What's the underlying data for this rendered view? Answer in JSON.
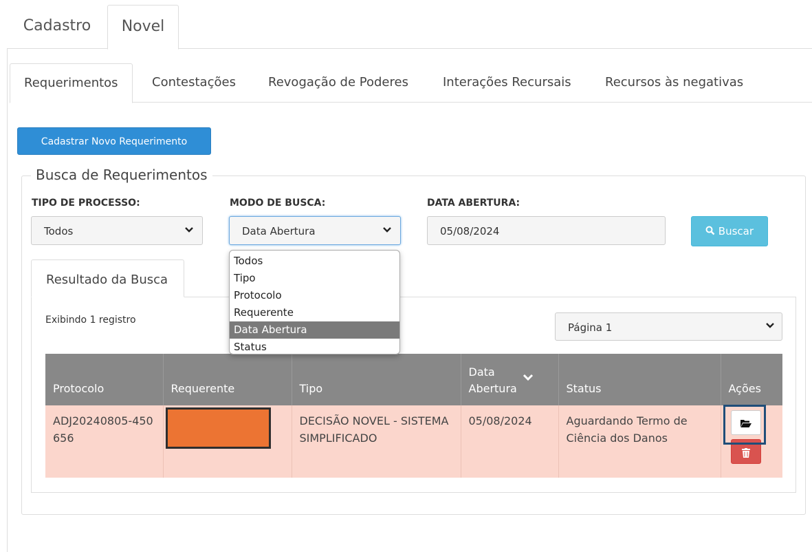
{
  "top_tabs": [
    {
      "label": "Cadastro"
    },
    {
      "label": "Novel"
    }
  ],
  "sub_tabs": [
    {
      "label": "Requerimentos"
    },
    {
      "label": "Contestações"
    },
    {
      "label": "Revogação de Poderes"
    },
    {
      "label": "Interações Recursais"
    },
    {
      "label": "Recursos às negativas"
    }
  ],
  "new_button": "Cadastrar Novo Requerimento",
  "search": {
    "legend": "Busca de Requerimentos",
    "tipo_label": "TIPO DE PROCESSO:",
    "tipo_value": "Todos",
    "modo_label": "MODO DE BUSCA:",
    "modo_value": "Data Abertura",
    "data_label": "DATA ABERTURA:",
    "data_value": "05/08/2024",
    "buscar": "Buscar"
  },
  "dropdown_options": [
    "Todos",
    "Tipo",
    "Protocolo",
    "Requerente",
    "Data Abertura",
    "Status"
  ],
  "dropdown_selected": "Data Abertura",
  "results": {
    "tab": "Resultado da Busca",
    "count": "Exibindo 1 registro",
    "page": "Página 1",
    "headers": [
      "Protocolo",
      "Requerente",
      "Tipo",
      "Data Abertura",
      "Status",
      "Ações"
    ],
    "rows": [
      {
        "protocolo": "ADJ20240805-450656",
        "requerente": "",
        "tipo": "DECISÃO NOVEL - SISTEMA SIMPLIFICADO",
        "data": "05/08/2024",
        "status": "Aguardando Termo de Ciência dos Danos"
      }
    ]
  },
  "colors": {
    "primary": "#2f8ed6",
    "info": "#5bc0de",
    "danger": "#d9534f",
    "row_bg": "#fbd6cc",
    "header_bg": "#888888",
    "redaction": "#ec7433"
  }
}
